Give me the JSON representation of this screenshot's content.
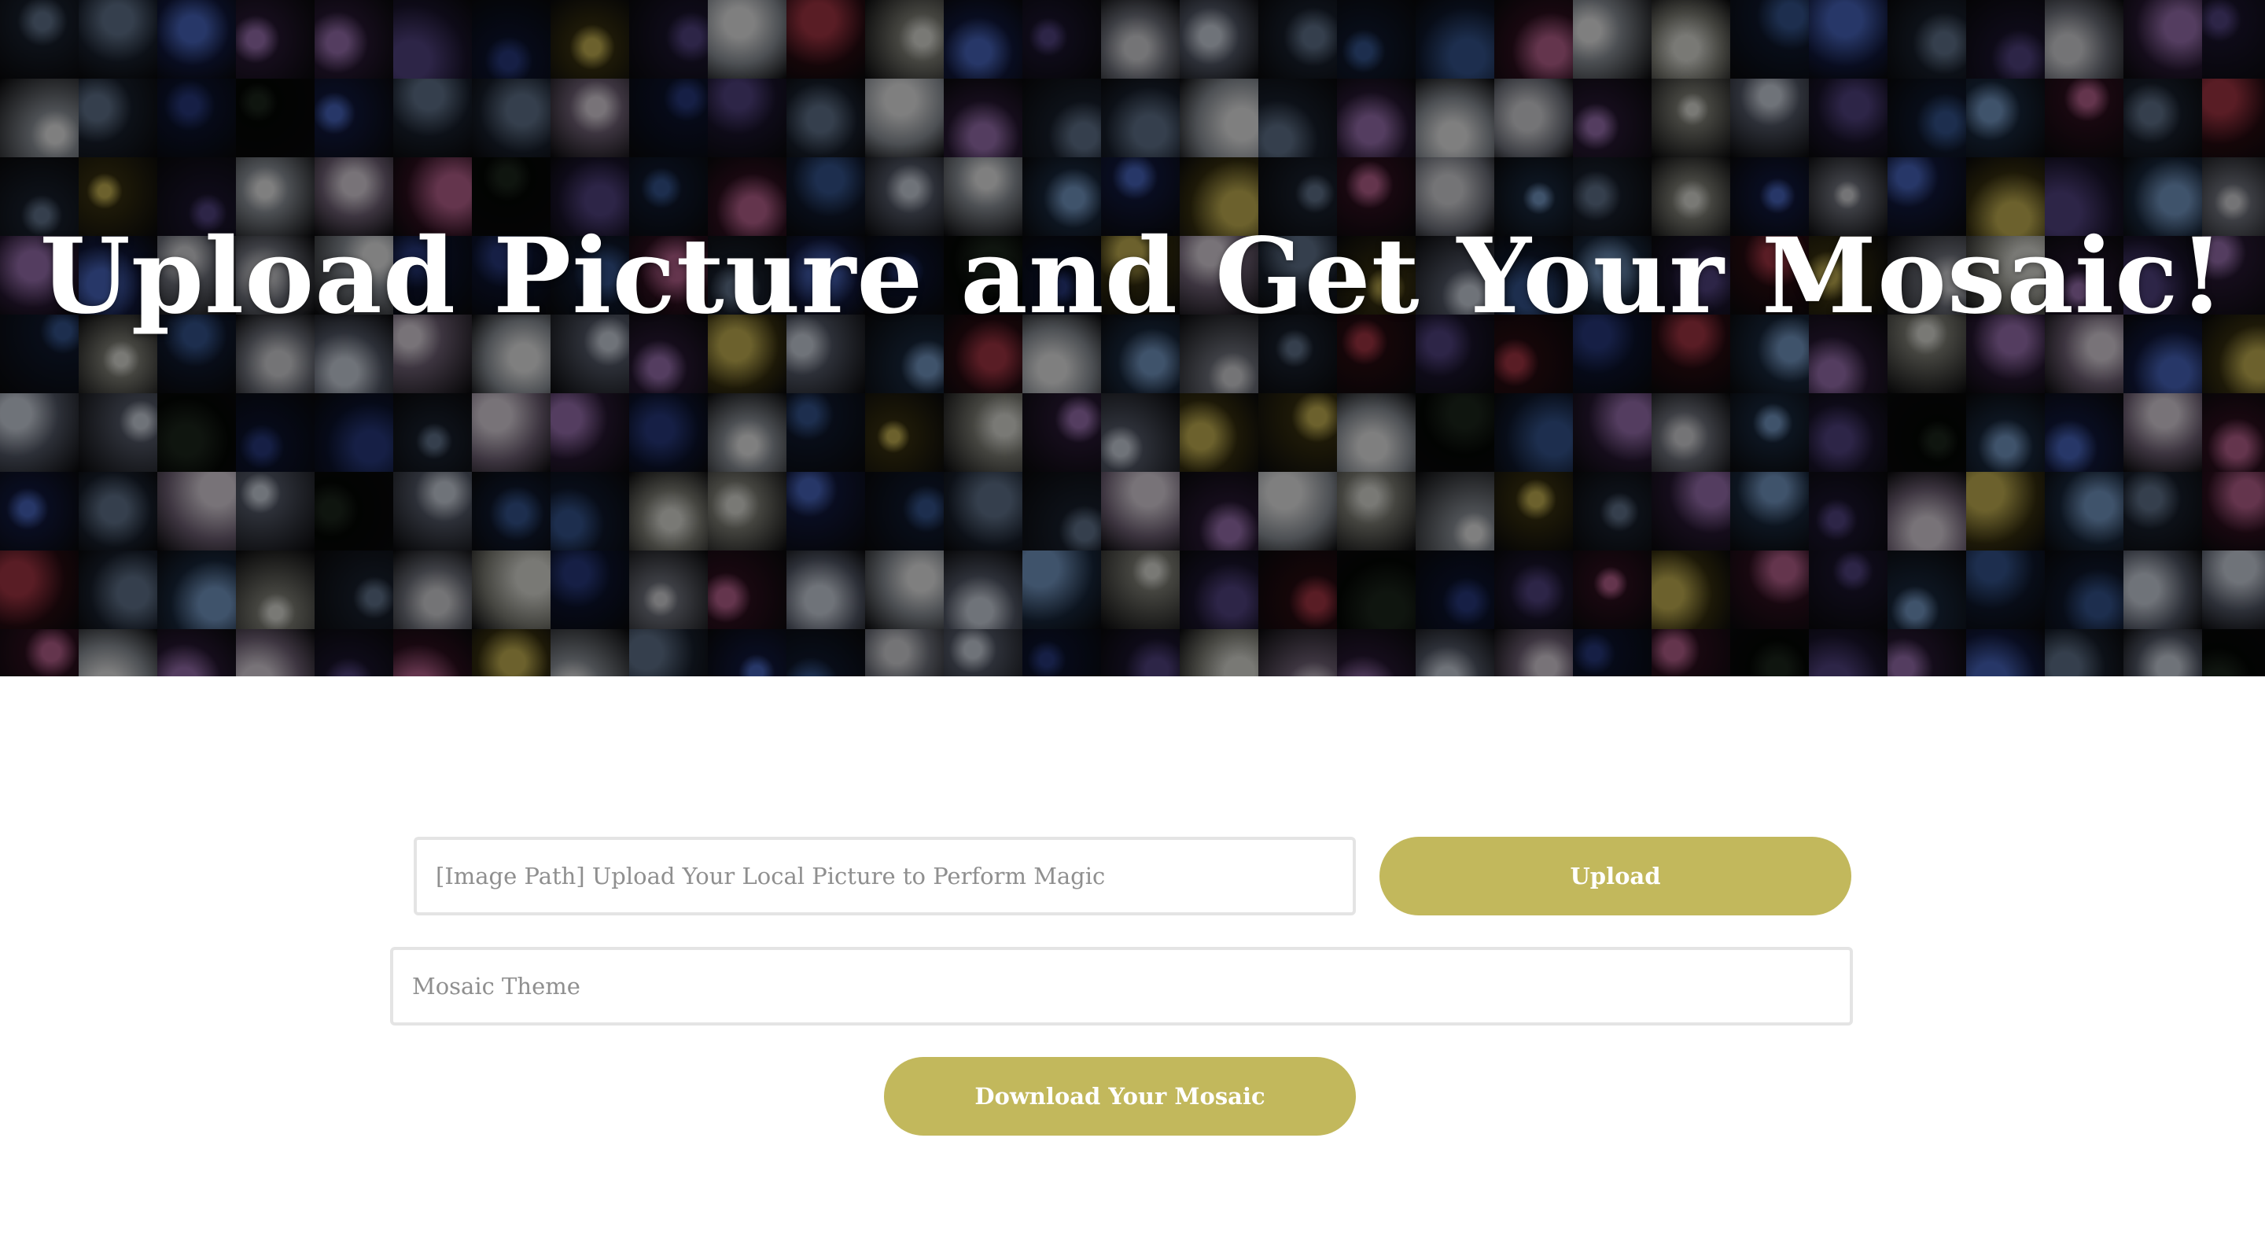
{
  "hero": {
    "title": "Upload Picture and Get Your Mosaic!",
    "background": "flower-photo-mosaic",
    "overlay_color": "#000000"
  },
  "form": {
    "image_path": {
      "value": "",
      "placeholder": "[Image Path] Upload Your Local Picture to Perform Magic"
    },
    "upload_label": "Upload",
    "mosaic_theme": {
      "value": "",
      "placeholder": "Mosaic Theme"
    },
    "download_label": "Download Your Mosaic"
  },
  "colors": {
    "accent": "#c2b85c",
    "input_border": "#e4e4e4",
    "placeholder": "#8f8f8f",
    "title_text": "#ffffff"
  }
}
